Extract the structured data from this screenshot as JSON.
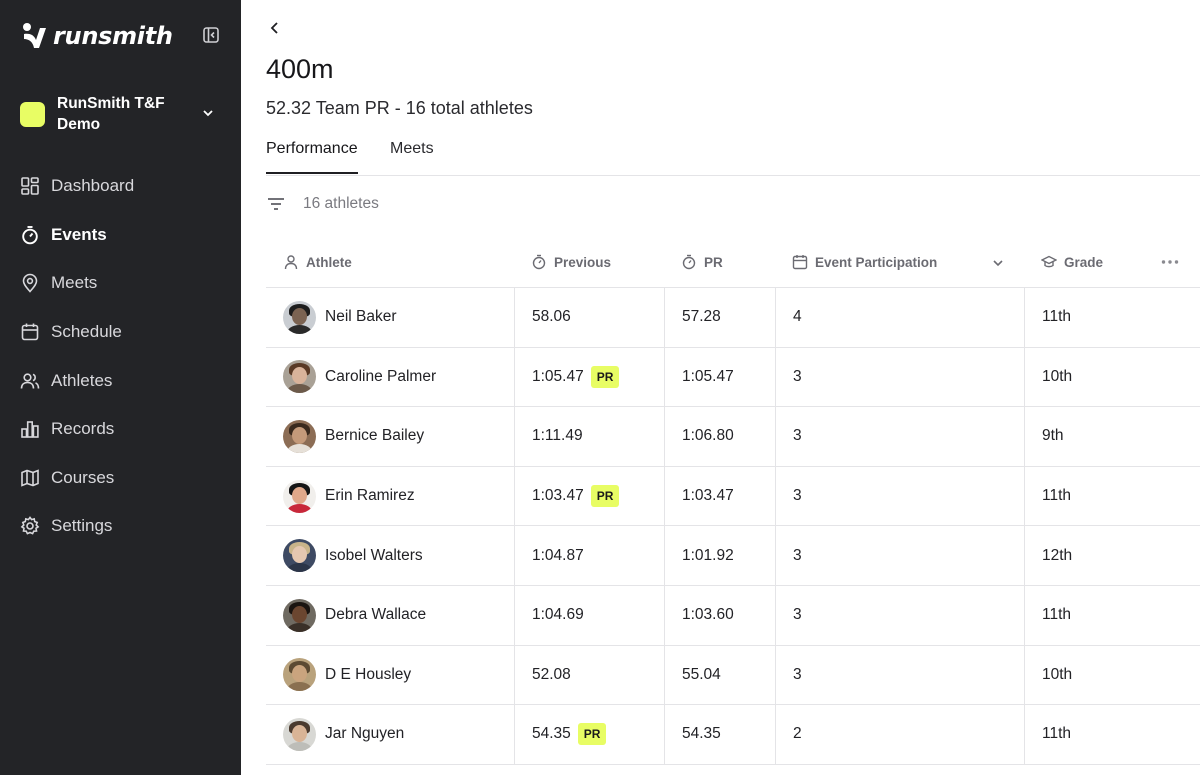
{
  "brand": {
    "name": "runsmith"
  },
  "org": {
    "name": "RunSmith T&F Demo"
  },
  "nav": [
    {
      "label": "Dashboard",
      "icon": "dashboard-icon"
    },
    {
      "label": "Events",
      "icon": "stopwatch-icon",
      "active": true
    },
    {
      "label": "Meets",
      "icon": "map-pin-icon"
    },
    {
      "label": "Schedule",
      "icon": "calendar-icon"
    },
    {
      "label": "Athletes",
      "icon": "users-icon"
    },
    {
      "label": "Records",
      "icon": "bar-chart-icon"
    },
    {
      "label": "Courses",
      "icon": "map-icon"
    },
    {
      "label": "Settings",
      "icon": "gear-icon"
    }
  ],
  "page": {
    "title": "400m",
    "subtitle": "52.32 Team PR - 16 total athletes"
  },
  "tabs": [
    {
      "label": "Performance",
      "active": true
    },
    {
      "label": "Meets"
    }
  ],
  "filter": {
    "count_label": "16 athletes"
  },
  "table": {
    "headers": {
      "athlete": "Athlete",
      "previous": "Previous",
      "pr": "PR",
      "participation": "Event Participation",
      "grade": "Grade"
    },
    "rows": [
      {
        "name": "Neil Baker",
        "previous": "58.06",
        "pr": "57.28",
        "participation": "4",
        "grade": "11th",
        "pr_badge": ""
      },
      {
        "name": "Caroline Palmer",
        "previous": "1:05.47",
        "pr": "1:05.47",
        "participation": "3",
        "grade": "10th",
        "pr_badge": "PR"
      },
      {
        "name": "Bernice Bailey",
        "previous": "1:11.49",
        "pr": "1:06.80",
        "participation": "3",
        "grade": "9th",
        "pr_badge": ""
      },
      {
        "name": "Erin Ramirez",
        "previous": "1:03.47",
        "pr": "1:03.47",
        "participation": "3",
        "grade": "11th",
        "pr_badge": "PR"
      },
      {
        "name": "Isobel Walters",
        "previous": "1:04.87",
        "pr": "1:01.92",
        "participation": "3",
        "grade": "12th",
        "pr_badge": ""
      },
      {
        "name": "Debra Wallace",
        "previous": "1:04.69",
        "pr": "1:03.60",
        "participation": "3",
        "grade": "11th",
        "pr_badge": ""
      },
      {
        "name": "D E Housley",
        "previous": "52.08",
        "pr": "55.04",
        "participation": "3",
        "grade": "10th",
        "pr_badge": ""
      },
      {
        "name": "Jar Nguyen",
        "previous": "54.35",
        "pr": "54.35",
        "participation": "2",
        "grade": "11th",
        "pr_badge": "PR"
      }
    ]
  },
  "colors": {
    "sidebar_bg": "#232427",
    "accent": "#e8fd64",
    "border": "#e4e4e7"
  }
}
